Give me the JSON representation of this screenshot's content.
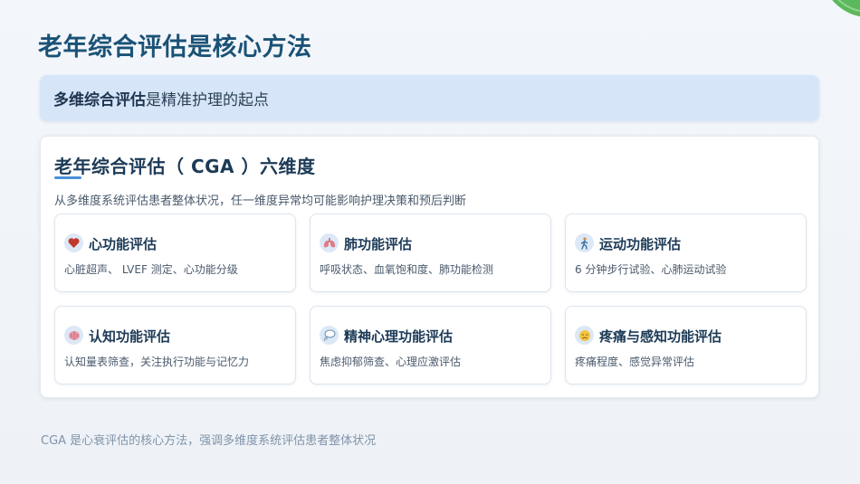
{
  "page": {
    "title": "老年综合评估是核心方法"
  },
  "highlight": {
    "strong_text": "多维综合评估",
    "rest_text": "是精准护理的起点"
  },
  "card": {
    "title": "老年综合评估（ CGA ）六维度",
    "subtitle": "从多维度系统评估患者整体状况，任一维度异常均可能影响护理决策和预后判断",
    "dimensions": [
      {
        "name": "心功能评估",
        "desc": "心脏超声、 LVEF 测定、心功能分级",
        "icon": "heart-icon"
      },
      {
        "name": "肺功能评估",
        "desc": "呼吸状态、血氧饱和度、肺功能检测",
        "icon": "lungs-icon"
      },
      {
        "name": "运动功能评估",
        "desc": "6 分钟步行试验、心肺运动试验",
        "icon": "walking-icon"
      },
      {
        "name": "认知功能评估",
        "desc": "认知量表筛查，关注执行功能与记忆力",
        "icon": "brain-icon"
      },
      {
        "name": "精神心理功能评估",
        "desc": "焦虑抑郁筛查、心理应激评估",
        "icon": "thought-bubble-icon"
      },
      {
        "name": "疼痛与感知功能评估",
        "desc": "疼痛程度、感觉异常评估",
        "icon": "face-icon"
      }
    ]
  },
  "footer": {
    "note": "CGA 是心衰评估的核心方法，强调多维度系统评估患者整体状况"
  },
  "colors": {
    "title": "#1a5276",
    "highlight_bg": "#d6e6f8",
    "accent": "#4a90d9"
  }
}
